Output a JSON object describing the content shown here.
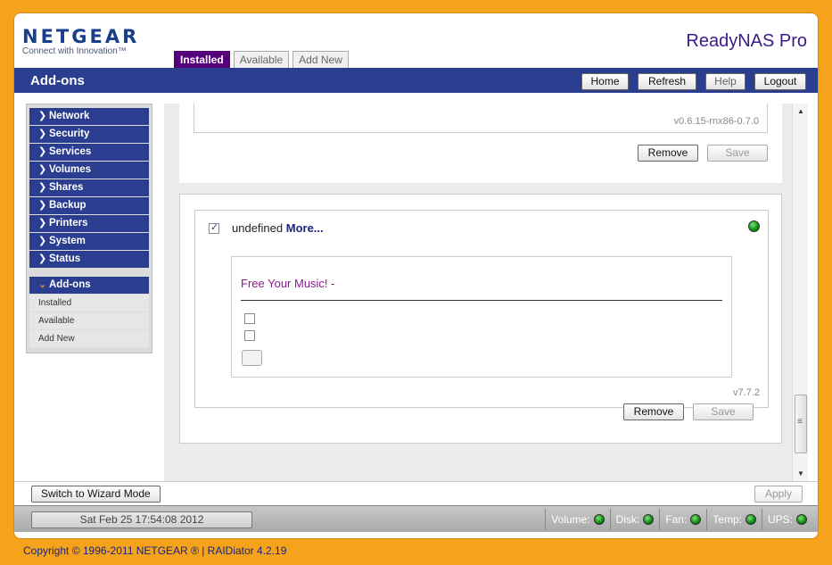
{
  "header": {
    "brand": "NETGEAR",
    "tagline": "Connect with Innovation™",
    "product": "ReadyNAS Pro",
    "tabs": [
      {
        "label": "Installed",
        "active": true
      },
      {
        "label": "Available",
        "active": false
      },
      {
        "label": "Add New",
        "active": false
      }
    ],
    "page_title": "Add-ons",
    "buttons": {
      "home": "Home",
      "refresh": "Refresh",
      "help": "Help",
      "logout": "Logout"
    }
  },
  "sidebar": {
    "items": [
      {
        "label": "Network"
      },
      {
        "label": "Security"
      },
      {
        "label": "Services"
      },
      {
        "label": "Volumes"
      },
      {
        "label": "Shares"
      },
      {
        "label": "Backup"
      },
      {
        "label": "Printers"
      },
      {
        "label": "System"
      },
      {
        "label": "Status"
      }
    ],
    "open_item": {
      "label": "Add-ons"
    },
    "sub_items": [
      {
        "label": "Installed"
      },
      {
        "label": "Available"
      },
      {
        "label": "Add New"
      }
    ]
  },
  "addons": [
    {
      "version": "v0.6.15-rnx86-0.7.0",
      "remove_label": "Remove",
      "save_label": "Save"
    },
    {
      "checked": true,
      "name": "undefined",
      "more_label": "More...",
      "status_color": "#0b8a0b",
      "inner_title": "Free Your Music! -",
      "version": "v7.7.2",
      "remove_label": "Remove",
      "save_label": "Save"
    }
  ],
  "footer": {
    "wizard_label": "Switch to Wizard Mode",
    "apply_label": "Apply",
    "datetime": "Sat Feb 25  17:54:08 2012",
    "sensors": [
      {
        "label": "Volume:"
      },
      {
        "label": "Disk:"
      },
      {
        "label": "Fan:"
      },
      {
        "label": "Temp:"
      },
      {
        "label": "UPS:"
      }
    ],
    "copyright": "Copyright © 1996-2011 NETGEAR ® | RAIDiator 4.2.19"
  }
}
